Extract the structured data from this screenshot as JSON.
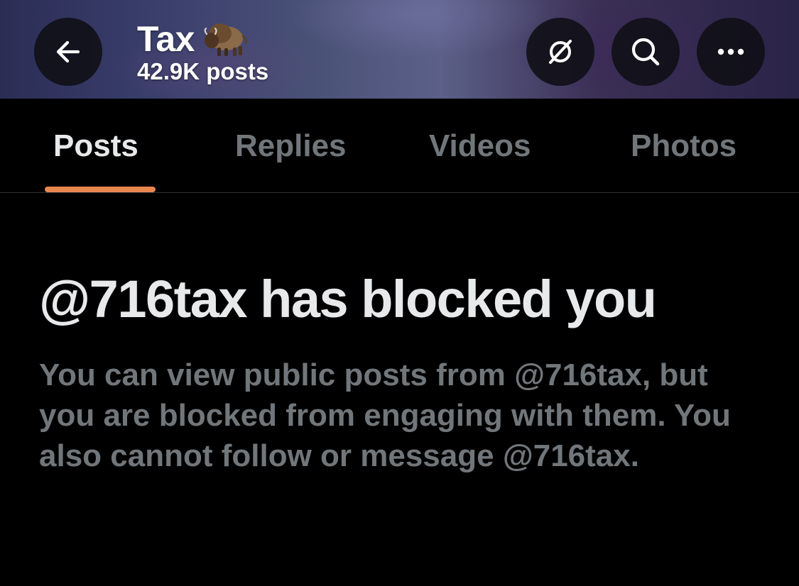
{
  "header": {
    "title": "Tax",
    "title_emoji_icon": "bison-icon",
    "post_count": "42.9K posts",
    "buttons": {
      "back_icon": "arrow-left-icon",
      "unfollow_icon": "unfollow-slash-icon",
      "search_icon": "search-icon",
      "more_icon": "more-horizontal-icon"
    }
  },
  "tabs": [
    {
      "label": "Posts",
      "active": true
    },
    {
      "label": "Replies",
      "active": false
    },
    {
      "label": "Videos",
      "active": false
    },
    {
      "label": "Photos",
      "active": false
    }
  ],
  "blocked": {
    "title": "@716tax has blocked you",
    "message": "You can view public posts from @716tax, but you are blocked from engaging with them. You also cannot follow or message @716tax."
  },
  "colors": {
    "background": "#000000",
    "primary_text": "#e7e9ea",
    "secondary_text": "#71767b",
    "tab_indicator": "#e8874f",
    "divider": "#2f3336"
  }
}
